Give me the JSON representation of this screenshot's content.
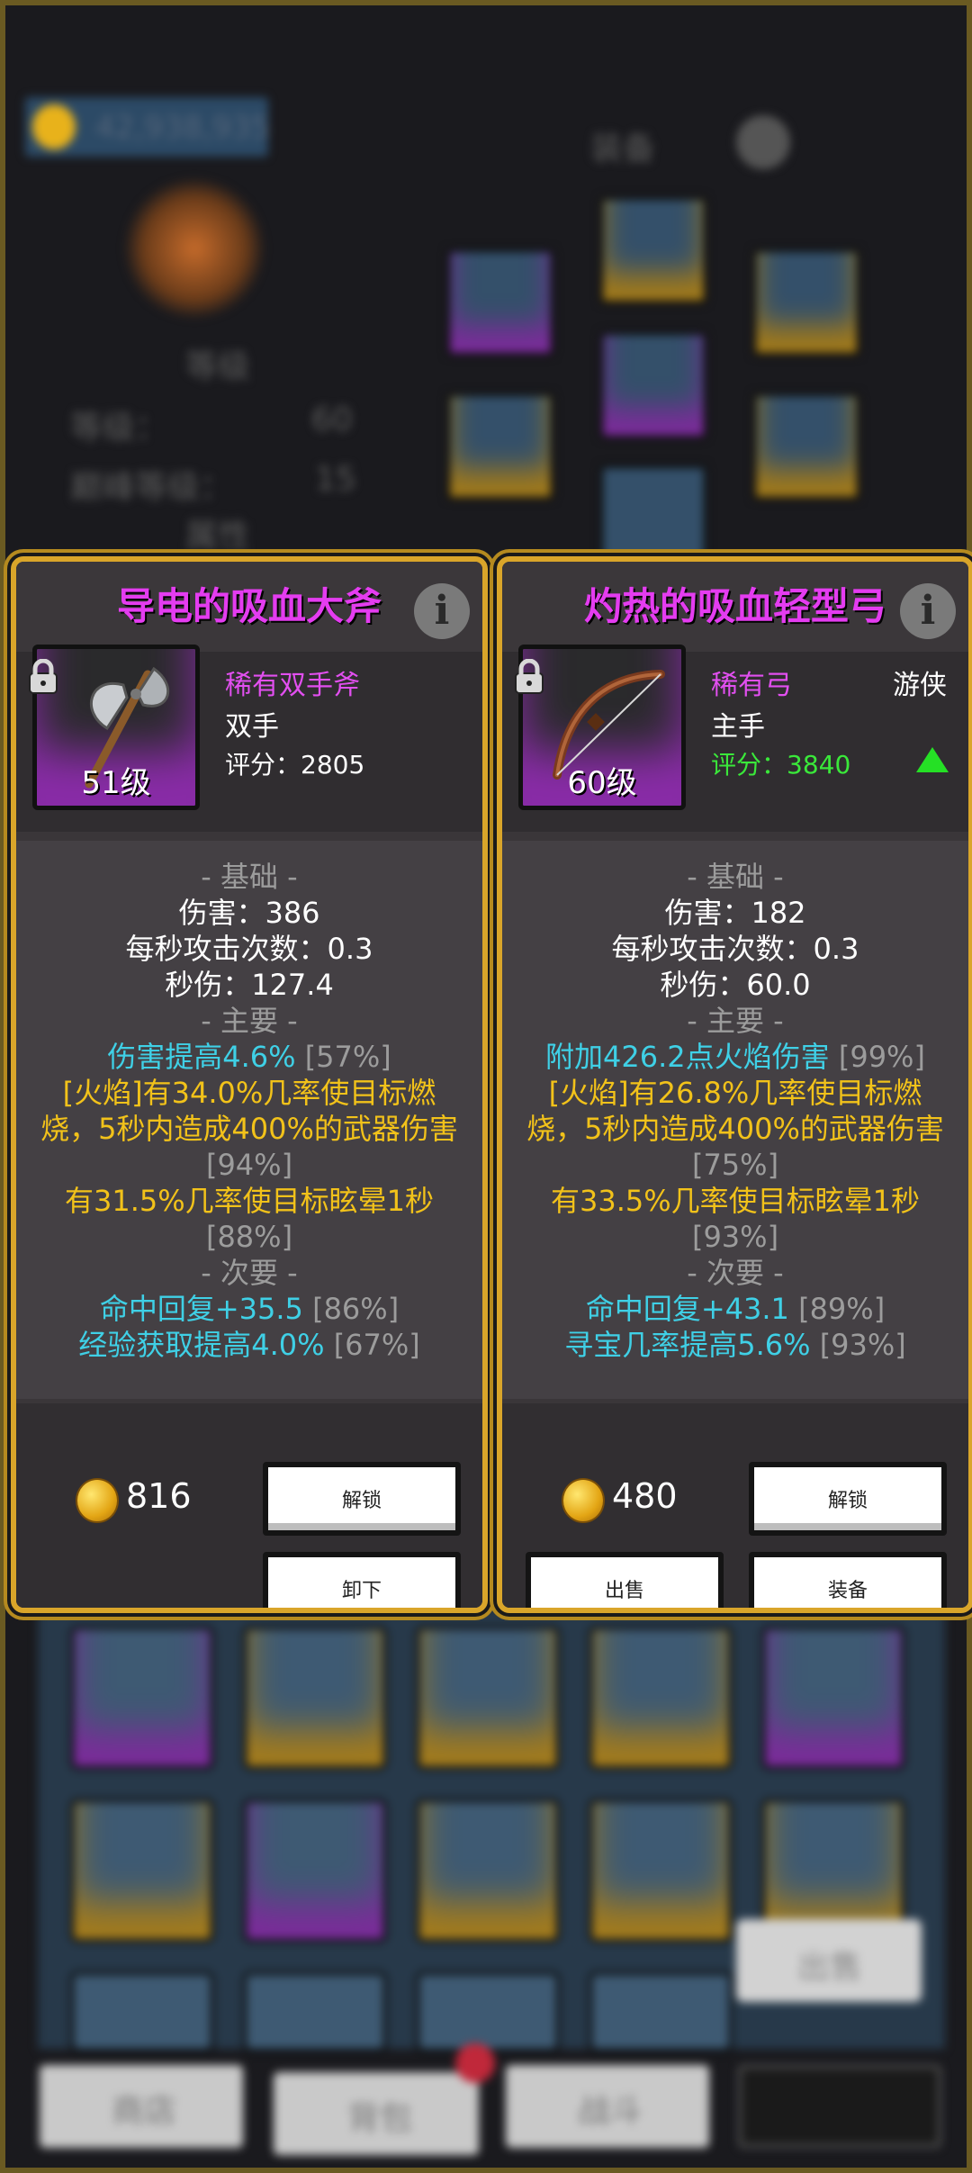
{
  "background": {
    "gold_amount": "42,938,935",
    "equip_header": "装备",
    "level_header": "等级",
    "level_label": "等级：",
    "level_value": "60",
    "peak_label": "巅峰等级：",
    "peak_value": "15",
    "attr_header": "属性",
    "sell_button": "出售",
    "nav": [
      "商店",
      "背包",
      "战斗"
    ]
  },
  "left_card": {
    "title": "导电的吸血大斧",
    "info": "i",
    "level": "51级",
    "rarity": "稀有双手斧",
    "slot": "双手",
    "score": "评分：2805",
    "basic_header": "- 基础 -",
    "damage": "伤害：386",
    "attack_speed": "每秒攻击次数：0.3",
    "dps": "秒伤：127.4",
    "primary_header": "- 主要 -",
    "primary": [
      {
        "text": "伤害提高4.6%",
        "pct": "[57%]",
        "color": "cyan"
      },
      {
        "text": "[火焰]有34.0%几率使目标燃烧，5秒内造成400%的武器伤害",
        "pct": "[94%]",
        "color": "yellow"
      },
      {
        "text": "有31.5%几率使目标眩晕1秒",
        "pct": "[88%]",
        "color": "yellow"
      }
    ],
    "secondary_header": "- 次要 -",
    "secondary": [
      {
        "text": "命中回复+35.5",
        "pct": "[86%]"
      },
      {
        "text": "经验获取提高4.0%",
        "pct": "[67%]"
      }
    ],
    "price": "816",
    "buttons": {
      "unlock": "解锁",
      "unequip": "卸下"
    }
  },
  "right_card": {
    "title": "灼热的吸血轻型弓",
    "info": "i",
    "level": "60级",
    "rarity": "稀有弓",
    "class": "游侠",
    "slot": "主手",
    "score": "评分：3840",
    "basic_header": "- 基础 -",
    "damage": "伤害：182",
    "attack_speed": "每秒攻击次数：0.3",
    "dps": "秒伤：60.0",
    "primary_header": "- 主要 -",
    "primary": [
      {
        "text": "附加426.2点火焰伤害",
        "pct": "[99%]",
        "color": "cyan"
      },
      {
        "text": "[火焰]有26.8%几率使目标燃烧，5秒内造成400%的武器伤害",
        "pct": "[75%]",
        "color": "yellow"
      },
      {
        "text": "有33.5%几率使目标眩晕1秒",
        "pct": "[93%]",
        "color": "yellow"
      }
    ],
    "secondary_header": "- 次要 -",
    "secondary": [
      {
        "text": "命中回复+43.1",
        "pct": "[89%]"
      },
      {
        "text": "寻宝几率提高5.6%",
        "pct": "[93%]"
      }
    ],
    "price": "480",
    "buttons": {
      "unlock": "解锁",
      "sell": "出售",
      "equip": "装备"
    }
  },
  "colors": {
    "title": "#e43cf0",
    "frame": "#d9a52a",
    "cyan": "#3fd0e6",
    "yellow": "#f2c21a",
    "green": "#3ae83a"
  },
  "icons": [
    "lock-icon",
    "axe-icon",
    "bow-icon",
    "coin-icon",
    "up-arrow-icon",
    "info-icon"
  ]
}
